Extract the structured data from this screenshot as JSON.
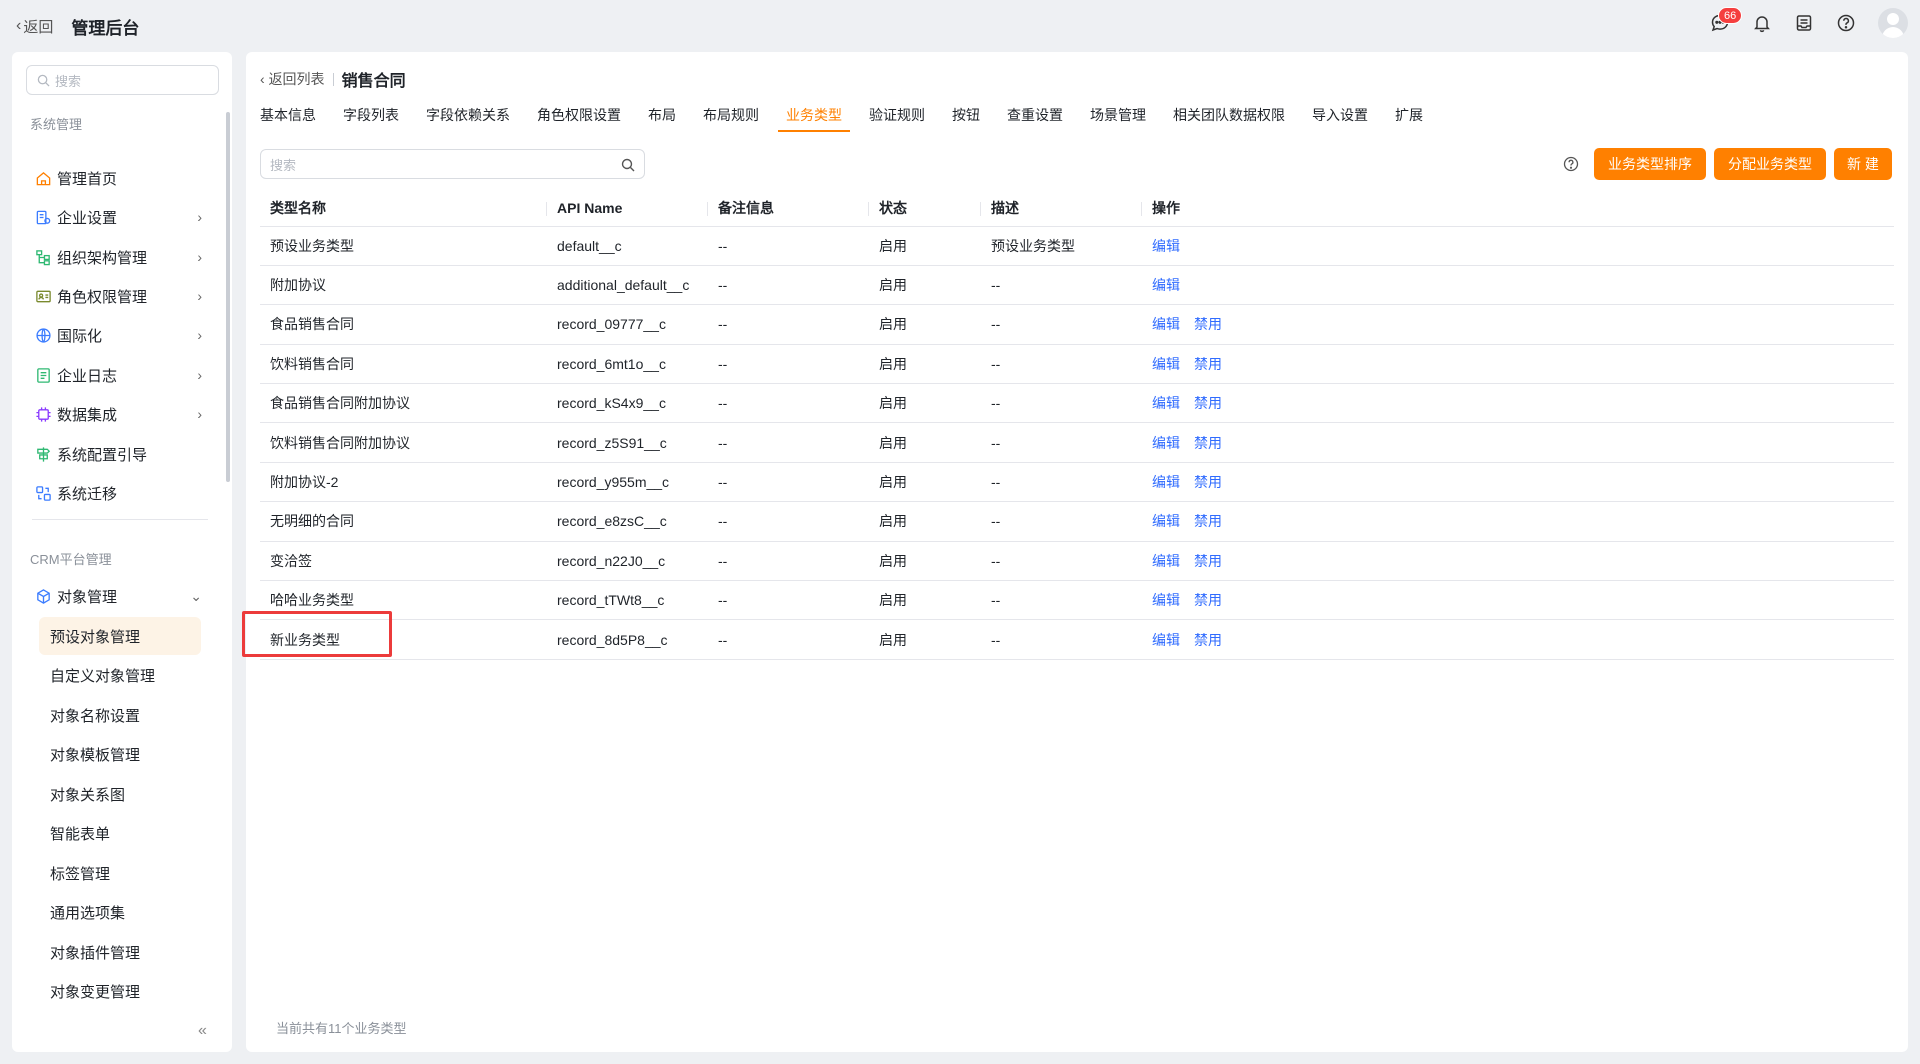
{
  "topbar": {
    "back_label": "返回",
    "title": "管理后台",
    "message_badge": "66"
  },
  "sidebar": {
    "search_placeholder": "搜索",
    "group1_title": "系统管理",
    "group1_items": [
      {
        "label": "管理首页",
        "icon": "home-icon"
      },
      {
        "label": "企业设置",
        "icon": "company-settings-icon"
      },
      {
        "label": "组织架构管理",
        "icon": "org-structure-icon"
      },
      {
        "label": "角色权限管理",
        "icon": "role-permission-icon"
      },
      {
        "label": "国际化",
        "icon": "globe-icon"
      },
      {
        "label": "企业日志",
        "icon": "log-icon"
      },
      {
        "label": "数据集成",
        "icon": "chip-icon"
      },
      {
        "label": "系统配置引导",
        "icon": "signpost-icon"
      },
      {
        "label": "系统迁移",
        "icon": "migration-icon"
      }
    ],
    "group2_title": "CRM平台管理",
    "object_mgmt_label": "对象管理",
    "sub_items": [
      "预设对象管理",
      "自定义对象管理",
      "对象名称设置",
      "对象模板管理",
      "对象关系图",
      "智能表单",
      "标签管理",
      "通用选项集",
      "对象插件管理",
      "对象变更管理"
    ]
  },
  "main": {
    "back_list_label": "返回列表",
    "page_title": "销售合同",
    "tabs": [
      "基本信息",
      "字段列表",
      "字段依赖关系",
      "角色权限设置",
      "布局",
      "布局规则",
      "业务类型",
      "验证规则",
      "按钮",
      "查重设置",
      "场景管理",
      "相关团队数据权限",
      "导入设置",
      "扩展"
    ],
    "active_tab": "业务类型",
    "search_placeholder": "搜索",
    "buttons": {
      "sort": "业务类型排序",
      "assign": "分配业务类型",
      "new": "新 建"
    },
    "table": {
      "headers": [
        "类型名称",
        "API Name",
        "备注信息",
        "状态",
        "描述",
        "操作"
      ],
      "rows": [
        {
          "name": "预设业务类型",
          "api": "default__c",
          "remark": "--",
          "status": "启用",
          "desc": "预设业务类型",
          "ops": [
            "编辑"
          ]
        },
        {
          "name": "附加协议",
          "api": "additional_default__c",
          "remark": "--",
          "status": "启用",
          "desc": "--",
          "ops": [
            "编辑"
          ]
        },
        {
          "name": "食品销售合同",
          "api": "record_09777__c",
          "remark": "--",
          "status": "启用",
          "desc": "--",
          "ops": [
            "编辑",
            "禁用"
          ]
        },
        {
          "name": "饮料销售合同",
          "api": "record_6mt1o__c",
          "remark": "--",
          "status": "启用",
          "desc": "--",
          "ops": [
            "编辑",
            "禁用"
          ]
        },
        {
          "name": "食品销售合同附加协议",
          "api": "record_kS4x9__c",
          "remark": "--",
          "status": "启用",
          "desc": "--",
          "ops": [
            "编辑",
            "禁用"
          ]
        },
        {
          "name": "饮料销售合同附加协议",
          "api": "record_z5S91__c",
          "remark": "--",
          "status": "启用",
          "desc": "--",
          "ops": [
            "编辑",
            "禁用"
          ]
        },
        {
          "name": "附加协议-2",
          "api": "record_y955m__c",
          "remark": "--",
          "status": "启用",
          "desc": "--",
          "ops": [
            "编辑",
            "禁用"
          ]
        },
        {
          "name": "无明细的合同",
          "api": "record_e8zsC__c",
          "remark": "--",
          "status": "启用",
          "desc": "--",
          "ops": [
            "编辑",
            "禁用"
          ]
        },
        {
          "name": "变洽签",
          "api": "record_n22J0__c",
          "remark": "--",
          "status": "启用",
          "desc": "--",
          "ops": [
            "编辑",
            "禁用"
          ]
        },
        {
          "name": "哈哈业务类型",
          "api": "record_tTWt8__c",
          "remark": "--",
          "status": "启用",
          "desc": "--",
          "ops": [
            "编辑",
            "禁用"
          ]
        },
        {
          "name": "新业务类型",
          "api": "record_8d5P8__c",
          "remark": "--",
          "status": "启用",
          "desc": "--",
          "ops": [
            "编辑",
            "禁用"
          ]
        }
      ]
    },
    "footer_note": "当前共有11个业务类型"
  },
  "colors": {
    "accent": "#ff8000",
    "link": "#2f6bff",
    "highlight": "#ec3b3b"
  }
}
